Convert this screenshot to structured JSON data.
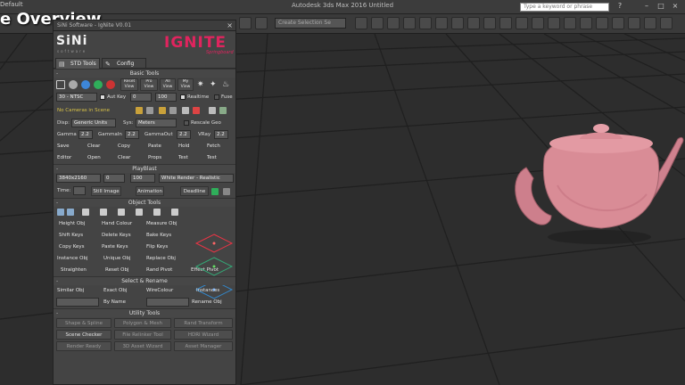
{
  "video_title": "e Overview",
  "window": {
    "top_left": "Default",
    "title": "Autodesk 3ds Max 2016     Untitled",
    "search_placeholder": "Type a keyword or phrase",
    "selection_set": "Create Selection Se"
  },
  "panel": {
    "title": "SiNi Software - IgNite V0.01",
    "close": "×",
    "logo_left": "SiNi",
    "logo_left_sub": "software",
    "logo_right": "IGNITE",
    "logo_right_sub": "Springboard",
    "tabs": [
      "STD Tools",
      "Config"
    ],
    "sections": {
      "basic": "Basic Tools",
      "playblast": "PlayBlast",
      "object": "Object Tools",
      "select": "Select & Rename",
      "utility": "Utility Tools"
    },
    "basic": {
      "view_buttons": [
        "Reset View",
        "Pro View",
        "All View",
        "My View"
      ],
      "fps": "30 - NTSC",
      "autokey": "Aut Key",
      "frame_start": "0",
      "frame_end": "100",
      "realtime": "Realtime",
      "fuse": "Fuse",
      "no_cameras": "No Cameras in Scene",
      "disp_label": "Disp:",
      "disp_value": "Generic Units",
      "sys_label": "Sys:",
      "sys_value": "Meters",
      "rescale": "Rescale Geo",
      "gamma": "Gamma",
      "gamma_v": "2.2",
      "gammain": "GammaIn",
      "gammain_v": "2.2",
      "gammaout": "GammaOut",
      "gammaout_v": "2.2",
      "vray": "VRay",
      "vray_v": "2.2",
      "row_a": [
        "Save",
        "Clear",
        "Copy",
        "Paste",
        "Hold",
        "Fetch"
      ],
      "row_b": [
        "Editor",
        "Open",
        "Clear",
        "Props",
        "Test",
        "Test"
      ]
    },
    "playblast": {
      "resolution": "3840x2160",
      "start": "0",
      "end": "100",
      "render_mode": "White Render - Realistic",
      "time": "Time:",
      "still": "Still Image",
      "animation": "Animation",
      "deadline": "Deadline"
    },
    "object": {
      "rows": [
        [
          "Height Obj",
          "Hand Colour",
          "Measure Obj"
        ],
        [
          "Shift Keys",
          "Delete Keys",
          "Bake Keys"
        ],
        [
          "Copy Keys",
          "Paste Keys",
          "Flip Keys"
        ],
        [
          "Instance Obj",
          "Unique Obj",
          "Replace Obj"
        ],
        [
          "Straighten",
          "Reset Obj",
          "Rand Pivot",
          "Effect Pivot"
        ]
      ]
    },
    "select": {
      "row1": [
        "Similar Obj",
        "Exact Obj",
        "WireColour",
        "Instances"
      ],
      "by_name": "By Name",
      "rename": "Rename Obj"
    },
    "utility": {
      "row1": [
        "Shape & Spline",
        "Polygon & Mesh",
        "Rand Transform"
      ],
      "row2": [
        "Scene Checker",
        "File Relinker Tool",
        "HDRI Wizard"
      ],
      "row3": [
        "Render Ready",
        "3D Asset Wizard",
        "Asset Manager"
      ]
    }
  },
  "colors": {
    "accent": "#e0245e",
    "teapot": "#d98c96",
    "viewport_bg": "#2d2d2d"
  }
}
